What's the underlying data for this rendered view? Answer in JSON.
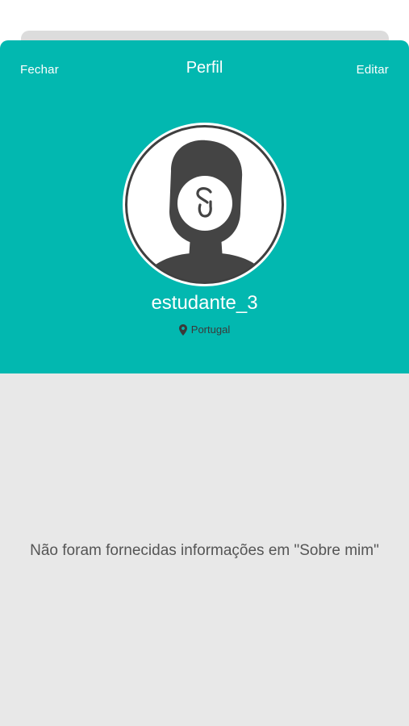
{
  "nav": {
    "close_label": "Fechar",
    "title": "Perfil",
    "edit_label": "Editar"
  },
  "profile": {
    "username": "estudante_3",
    "location": "Portugal",
    "about_empty": "Não foram fornecidas informações em \"Sobre mim\""
  },
  "icons": {
    "avatar": "default-avatar-silhouette-icon",
    "location": "map-pin-icon"
  },
  "colors": {
    "header": "#02b8b0",
    "body": "#e8e8e8"
  }
}
